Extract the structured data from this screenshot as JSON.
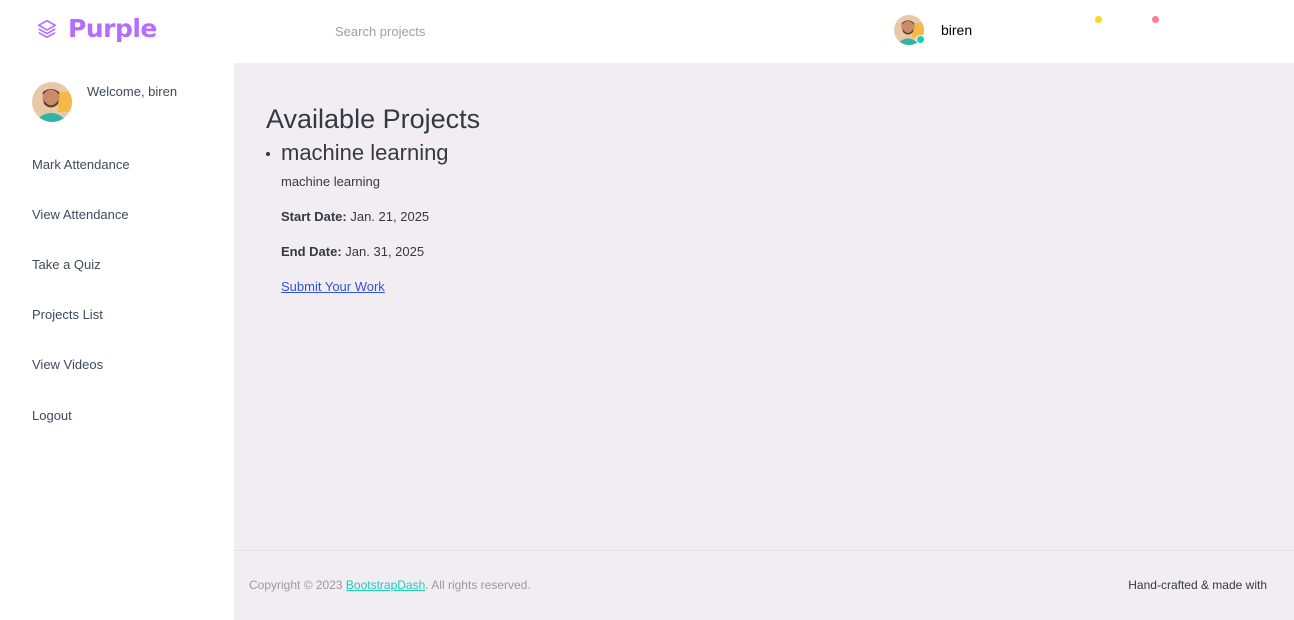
{
  "brand": {
    "name": "Purple",
    "color": "#b66dff"
  },
  "search": {
    "placeholder": "Search projects",
    "value": ""
  },
  "navbar": {
    "username": "biren",
    "indicator_colors": [
      "#fed713",
      "#fe7c96"
    ],
    "online_color": "#1bcfb4"
  },
  "sidebar": {
    "welcome": "Welcome, biren",
    "items": [
      {
        "label": "Mark Attendance"
      },
      {
        "label": "View Attendance"
      },
      {
        "label": "Take a Quiz"
      },
      {
        "label": "Projects List"
      },
      {
        "label": "View Videos"
      },
      {
        "label": "Logout"
      }
    ]
  },
  "main": {
    "heading": "Available Projects",
    "projects": [
      {
        "title": "machine learning",
        "description": "machine learning",
        "start_label": "Start Date:",
        "start_date": "Jan. 21, 2025",
        "end_label": "End Date:",
        "end_date": "Jan. 31, 2025",
        "submit_label": "Submit Your Work"
      }
    ]
  },
  "footer": {
    "copyright_prefix": "Copyright © 2023 ",
    "copyright_link": "BootstrapDash",
    "copyright_suffix": ". All rights reserved.",
    "handcrafted": "Hand-crafted & made with"
  }
}
